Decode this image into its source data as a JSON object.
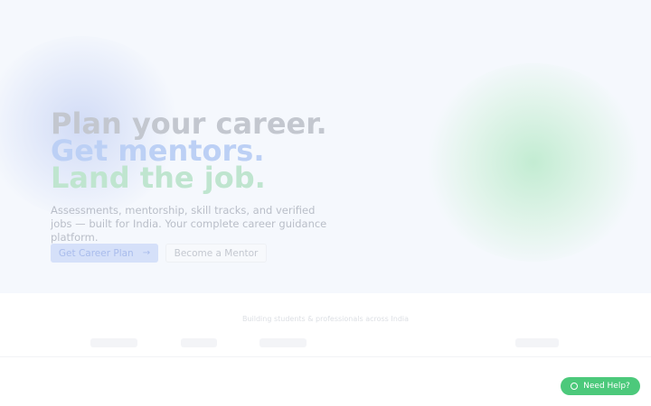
{
  "hero": {
    "headline": {
      "line1": "Plan your career.",
      "line2": "Get mentors.",
      "line3": "Land the job."
    },
    "subtitle": "Assessments, mentorship, skill tracks, and verified jobs — built for India. Your complete career guidance platform.",
    "primary_button": {
      "label": "Get Career Plan",
      "icon": "arrow-right-icon"
    },
    "secondary_button": {
      "label": "Become a Mentor"
    }
  },
  "trust": {
    "text": "Building students & professionals across India"
  },
  "help_button": {
    "label": "Need Help?",
    "icon": "chat-bubble-icon"
  },
  "colors": {
    "primary": "#d5e0f9",
    "help_green": "#4cc97b",
    "headline_blue": "#bcd0f5",
    "headline_green": "#bfe5cf"
  }
}
